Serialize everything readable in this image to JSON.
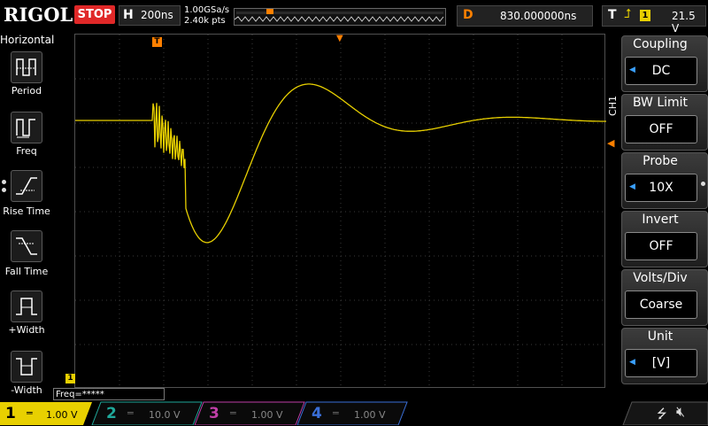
{
  "topbar": {
    "brand": "RIGOL",
    "run_state": "STOP",
    "horizontal_letter": "H",
    "timebase": "200ns",
    "sample_rate": "1.00GSa/s",
    "memory_depth": "2.40k pts",
    "delay_letter": "D",
    "delay_value": "830.000000ns",
    "trigger_letter": "T",
    "trigger_source": "1",
    "trigger_level": "21.5 V"
  },
  "left_panel": {
    "title": "Horizontal",
    "items": [
      {
        "label": "Period",
        "icon": "period-icon"
      },
      {
        "label": "Freq",
        "icon": "freq-icon"
      },
      {
        "label": "Rise Time",
        "icon": "rise-time-icon"
      },
      {
        "label": "Fall Time",
        "icon": "fall-time-icon"
      },
      {
        "label": "+Width",
        "icon": "pos-width-icon"
      },
      {
        "label": "-Width",
        "icon": "neg-width-icon"
      }
    ]
  },
  "right_panel": {
    "channel_tab": "CH1",
    "items": [
      {
        "title": "Coupling",
        "value": "DC"
      },
      {
        "title": "BW Limit",
        "value": "OFF"
      },
      {
        "title": "Probe",
        "value": "10X"
      },
      {
        "title": "Invert",
        "value": "OFF"
      },
      {
        "title": "Volts/Div",
        "value": "Coarse"
      },
      {
        "title": "Unit",
        "value": "[V]"
      }
    ]
  },
  "measurement": {
    "freq_readout": "Freq=*****"
  },
  "channels": [
    {
      "num": "1",
      "scale": "1.00 V",
      "color": "#e8d000",
      "active": true
    },
    {
      "num": "2",
      "scale": "10.0 V",
      "color": "#1fa89a",
      "active": false
    },
    {
      "num": "3",
      "scale": "1.00 V",
      "color": "#c03fa8",
      "active": false
    },
    {
      "num": "4",
      "scale": "1.00 V",
      "color": "#3a6fd8",
      "active": false
    }
  ],
  "markers": {
    "trigger_marker": "T",
    "ground_marker": "1"
  },
  "colors": {
    "ch1": "#e8d000",
    "stop": "#e02828",
    "delay": "#ff8000",
    "grid": "#505050"
  }
}
